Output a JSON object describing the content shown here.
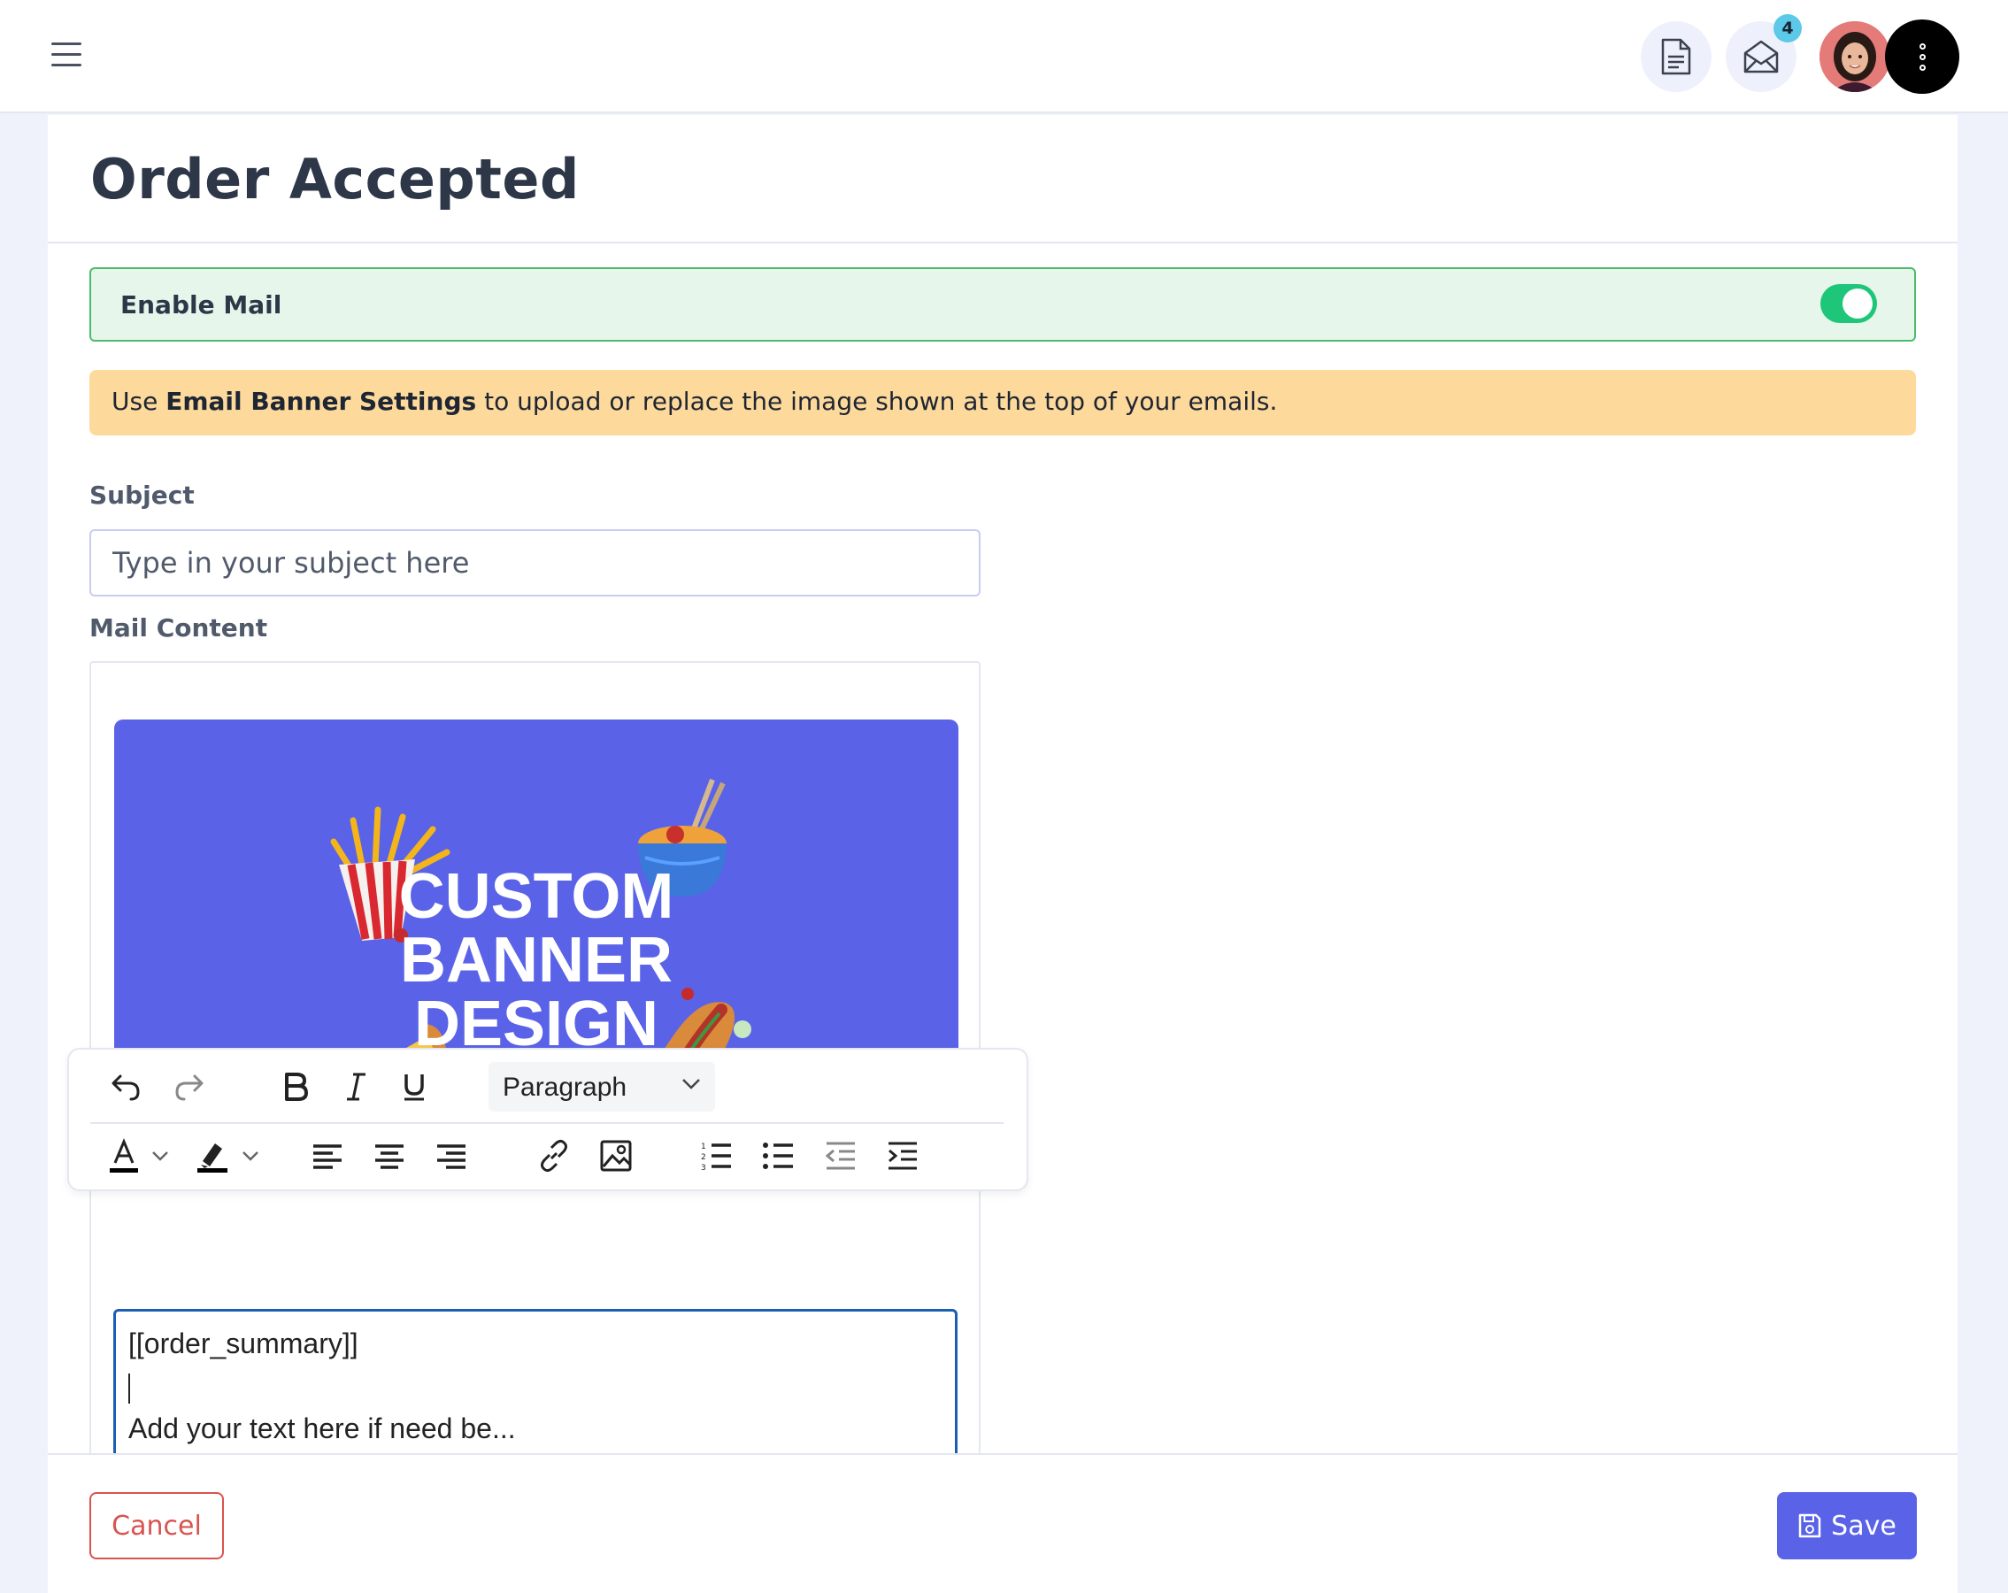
{
  "topbar": {
    "menu_icon": "hamburger-icon",
    "doc_icon": "document-icon",
    "mail_icon": "envelope-open-icon",
    "mail_badge": "4",
    "more_icon": "vertical-dots-icon"
  },
  "page": {
    "title": "Order Accepted"
  },
  "enable_mail": {
    "label": "Enable Mail",
    "enabled": true
  },
  "notice": {
    "prefix": "Use ",
    "link_text": "Email Banner Settings",
    "suffix": " to upload or replace the image shown at the top of your emails."
  },
  "subject": {
    "label": "Subject",
    "placeholder": "Type in your subject here",
    "value": ""
  },
  "mail_content": {
    "label": "Mail Content",
    "banner": {
      "line1": "CUSTOM",
      "line2": "BANNER",
      "line3": "DESIGN",
      "background": "#5a63e8"
    },
    "body_lines": [
      "[[order_summary]]",
      "",
      "Add your text here if need be..."
    ]
  },
  "toolbar": {
    "paragraph_select": "Paragraph",
    "buttons": [
      "undo-icon",
      "redo-icon",
      "bold-icon",
      "italic-icon",
      "underline-icon",
      "font-color-icon",
      "highlight-icon",
      "align-left-icon",
      "align-center-icon",
      "align-right-icon",
      "link-icon",
      "image-icon",
      "numbered-list-icon",
      "bullet-list-icon",
      "outdent-icon",
      "indent-icon"
    ]
  },
  "footer": {
    "cancel_label": "Cancel",
    "save_label": "Save"
  },
  "colors": {
    "accent": "#5a63e8",
    "toggle_on": "#1ec67a",
    "danger": "#d9534f",
    "notice_bg": "#fdd99b",
    "enable_bg": "#e6f6ea"
  }
}
